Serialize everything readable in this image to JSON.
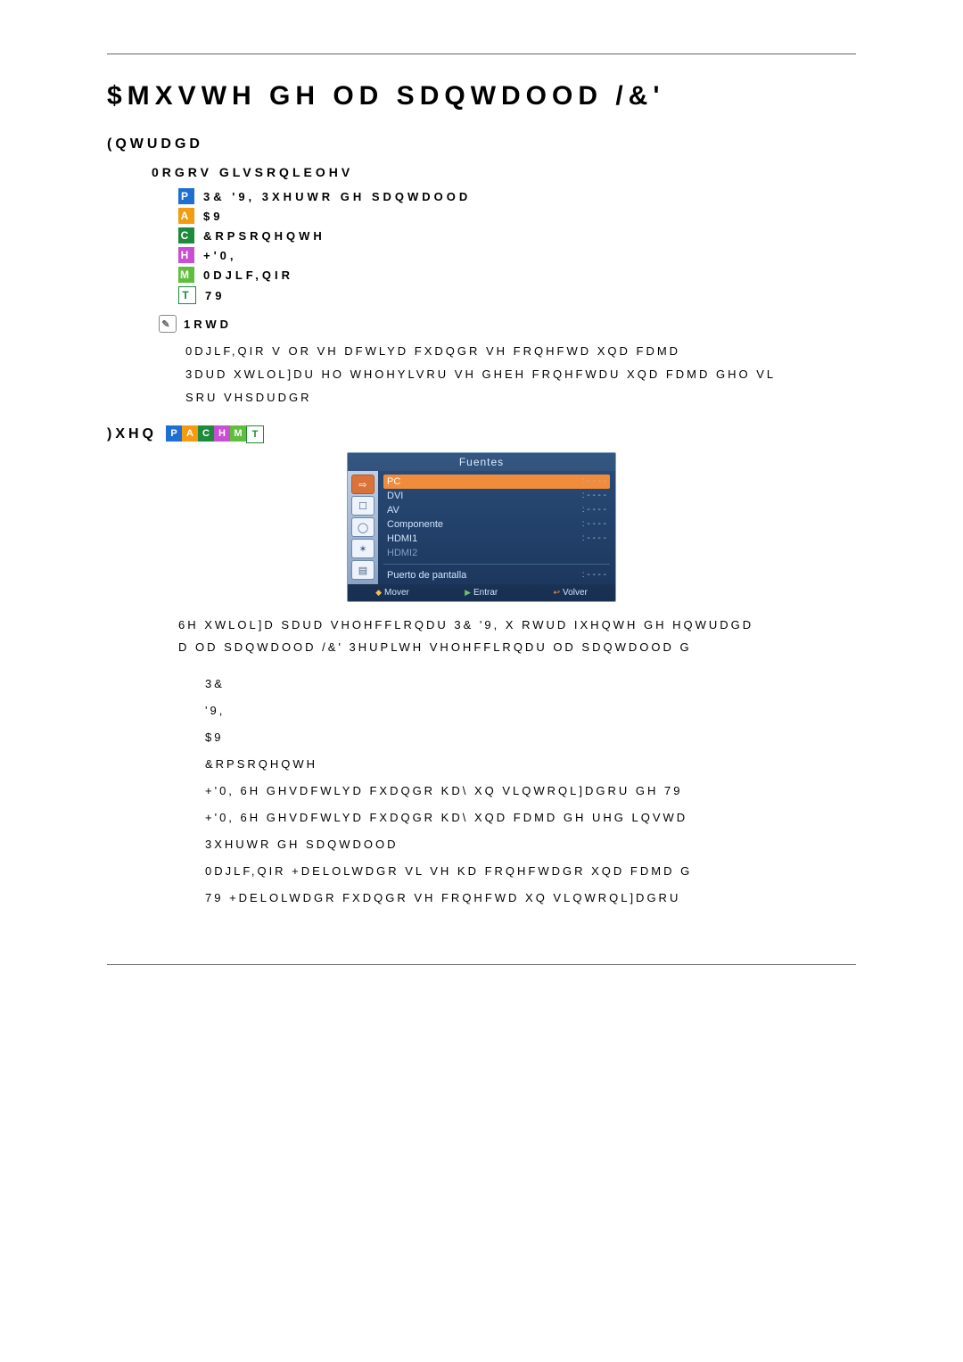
{
  "title": "$MXVWH GH OD SDQWDOOD /&'",
  "section_entrada": "(QWUDGD",
  "section_modos": "0RGRV GLVSRQLEOHV",
  "modes": {
    "p": {
      "letter": "P",
      "text": "3&   '9,  3XHUWR GH SDQWDOOD"
    },
    "a": {
      "letter": "A",
      "text": "$9"
    },
    "c": {
      "letter": "C",
      "text": "&RPSRQHQWH"
    },
    "h": {
      "letter": "H",
      "text": "+'0,"
    },
    "m": {
      "letter": "M",
      "text": "0DJLF,QIR"
    },
    "t": {
      "letter": "T",
      "text": "79"
    }
  },
  "note": {
    "title": "1RWD",
    "line1": "0DJLF,QIR V OR VH DFWLYD FXDQGR VH FRQHFWD XQD FDMD",
    "line2": "3DUD XWLOL]DU HO WHOHYLVRU VH GHEH FRQHFWDU XQD FDMD GHO VL",
    "line3": "SRU VHSDUDGR"
  },
  "fuente_heading": ")XHQ",
  "badges": [
    "P",
    "A",
    "C",
    "H",
    "M",
    "T"
  ],
  "osd": {
    "title": "Fuentes",
    "rows": [
      {
        "label": "PC",
        "selected": true
      },
      {
        "label": "DVI"
      },
      {
        "label": "AV"
      },
      {
        "label": "Componente"
      },
      {
        "label": "HDMI1"
      },
      {
        "label": "HDMI2",
        "dim": true
      },
      {
        "label": "Puerto de pantalla"
      }
    ],
    "footer": {
      "mover": "Mover",
      "entrar": "Entrar",
      "volver": "Volver"
    }
  },
  "para1_l1": "6H XWLOL]D SDUD VHOHFFLRQDU 3& '9, X RWUD IXHQWH GH HQWUDGD",
  "para1_l2": "D OD SDQWDOOD /&'  3HUPLWH VHOHFFLRQDU OD SDQWDOOD G",
  "numbered": {
    "n1": "3&",
    "n2": "'9,",
    "n3": "$9",
    "n4": "&RPSRQHQWH",
    "n5": "+'0,   6H GHVDFWLYD FXDQGR KD\\ XQ VLQWRQL]DGRU GH 79",
    "n6": "+'0,   6H GHVDFWLYD FXDQGR KD\\ XQD FDMD GH UHG LQVWD",
    "n7": "3XHUWR GH SDQWDOOD",
    "n8": "0DJLF,QIR  +DELOLWDGR VL VH KD FRQHFWDGR XQD FDMD G",
    "n9": "79  +DELOLWDGR FXDQGR VH FRQHFWD XQ VLQWRQL]DGRU"
  }
}
